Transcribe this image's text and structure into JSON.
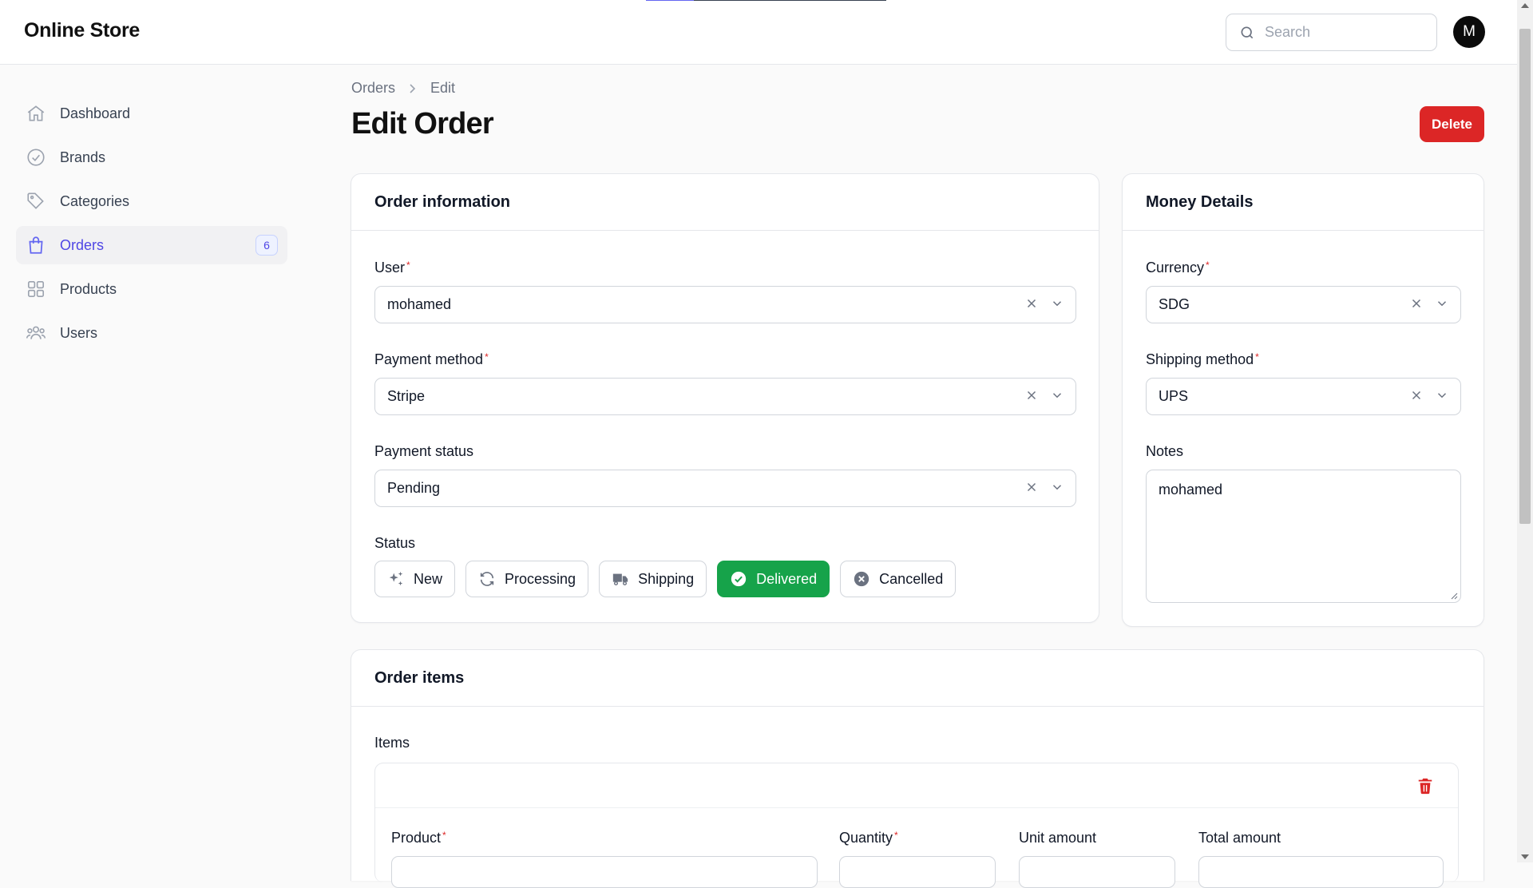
{
  "app": {
    "title": "Online Store",
    "user_initial": "M"
  },
  "search": {
    "placeholder": "Search"
  },
  "sidebar": {
    "items": [
      {
        "label": "Dashboard",
        "icon": "home-icon"
      },
      {
        "label": "Brands",
        "icon": "check-circle-icon"
      },
      {
        "label": "Categories",
        "icon": "tag-icon"
      },
      {
        "label": "Orders",
        "icon": "shopping-bag-icon",
        "badge": "6",
        "active": true
      },
      {
        "label": "Products",
        "icon": "grid-icon"
      },
      {
        "label": "Users",
        "icon": "users-icon"
      }
    ]
  },
  "breadcrumb": {
    "parent": "Orders",
    "current": "Edit"
  },
  "page": {
    "title": "Edit Order",
    "delete_label": "Delete"
  },
  "order_info": {
    "heading": "Order information",
    "user": {
      "label": "User",
      "value": "mohamed"
    },
    "payment_method": {
      "label": "Payment method",
      "value": "Stripe"
    },
    "payment_status": {
      "label": "Payment status",
      "value": "Pending"
    },
    "status": {
      "label": "Status",
      "options": [
        "New",
        "Processing",
        "Shipping",
        "Delivered",
        "Cancelled"
      ],
      "selected": "Delivered"
    }
  },
  "money": {
    "heading": "Money Details",
    "currency": {
      "label": "Currency",
      "value": "SDG"
    },
    "shipping_method": {
      "label": "Shipping method",
      "value": "UPS"
    },
    "notes": {
      "label": "Notes",
      "value": "mohamed"
    }
  },
  "order_items": {
    "heading": "Order items",
    "items_label": "Items",
    "columns": [
      "Product",
      "Quantity",
      "Unit amount",
      "Total amount"
    ]
  },
  "colors": {
    "accent": "#4f46e5",
    "danger": "#dc2626",
    "success": "#16a34a"
  }
}
